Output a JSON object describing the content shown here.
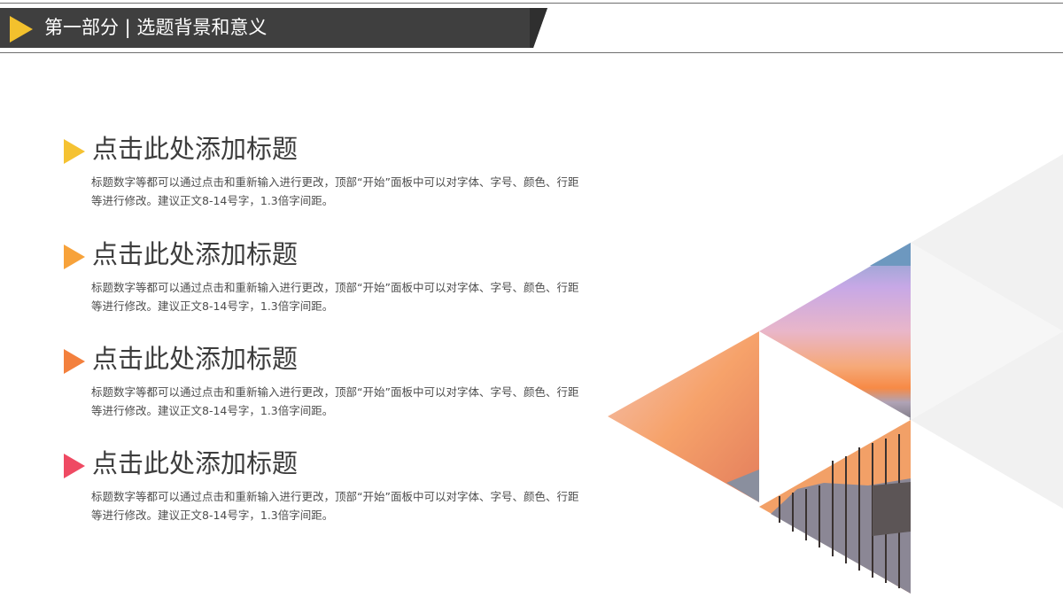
{
  "header": {
    "title": "第一部分 | 选题背景和意义"
  },
  "colors": {
    "header_bg": "#3f3f3f",
    "header_arrow": "#f3c12d",
    "bullet_1": "#f5c232",
    "bullet_2": "#f7a23a",
    "bullet_3": "#f3803d",
    "bullet_4": "#ef4a63",
    "grey_triangle": "#f1f1f1"
  },
  "sections": [
    {
      "title": "点击此处添加标题",
      "body": "标题数字等都可以通过点击和重新输入进行更改，顶部“开始”面板中可以对字体、字号、颜色、行距等进行修改。建议正文8-14号字，1.3倍字间距。"
    },
    {
      "title": "点击此处添加标题",
      "body": "标题数字等都可以通过点击和重新输入进行更改，顶部“开始”面板中可以对字体、字号、颜色、行距等进行修改。建议正文8-14号字，1.3倍字间距。"
    },
    {
      "title": "点击此处添加标题",
      "body": "标题数字等都可以通过点击和重新输入进行更改，顶部“开始”面板中可以对字体、字号、颜色、行距等进行修改。建议正文8-14号字，1.3倍字间距。"
    },
    {
      "title": "点击此处添加标题",
      "body": "标题数字等都可以通过点击和重新输入进行更改，顶部“开始”面板中可以对字体、字号、颜色、行距等进行修改。建议正文8-14号字，1.3倍字间距。"
    }
  ]
}
